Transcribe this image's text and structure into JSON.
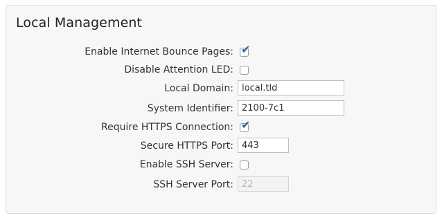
{
  "section": {
    "title": "Local Management"
  },
  "fields": {
    "bounce_pages": {
      "label": "Enable Internet Bounce Pages:",
      "checked": true
    },
    "attention_led": {
      "label": "Disable Attention LED:",
      "checked": false
    },
    "local_domain": {
      "label": "Local Domain:",
      "value": "local.tld"
    },
    "system_identifier": {
      "label": "System Identifier:",
      "value": "2100-7c1"
    },
    "require_https": {
      "label": "Require HTTPS Connection:",
      "checked": true
    },
    "https_port": {
      "label": "Secure HTTPS Port:",
      "value": "443"
    },
    "ssh_server": {
      "label": "Enable SSH Server:",
      "checked": false
    },
    "ssh_port": {
      "label": "SSH Server Port:",
      "value": "22",
      "disabled": true
    }
  },
  "icons": {
    "check": "checkmark-icon"
  },
  "colors": {
    "check": "#2f5fb3"
  }
}
